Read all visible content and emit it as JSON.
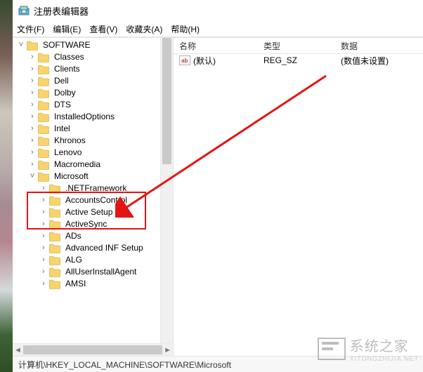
{
  "titlebar": {
    "title": "注册表编辑器"
  },
  "menu": {
    "file": "文件(F)",
    "edit": "编辑(E)",
    "view": "查看(V)",
    "favorites": "收藏夹(A)",
    "help": "帮助(H)"
  },
  "tree": [
    {
      "indent": 0,
      "expander": "open",
      "label": "SOFTWARE"
    },
    {
      "indent": 1,
      "expander": "close",
      "label": "Classes"
    },
    {
      "indent": 1,
      "expander": "close",
      "label": "Clients"
    },
    {
      "indent": 1,
      "expander": "close",
      "label": "Dell"
    },
    {
      "indent": 1,
      "expander": "close",
      "label": "Dolby"
    },
    {
      "indent": 1,
      "expander": "close",
      "label": "DTS"
    },
    {
      "indent": 1,
      "expander": "close",
      "label": "InstalledOptions"
    },
    {
      "indent": 1,
      "expander": "close",
      "label": "Intel"
    },
    {
      "indent": 1,
      "expander": "close",
      "label": "Khronos"
    },
    {
      "indent": 1,
      "expander": "close",
      "label": "Lenovo"
    },
    {
      "indent": 1,
      "expander": "close",
      "label": "Macromedia"
    },
    {
      "indent": 1,
      "expander": "open",
      "label": "Microsoft"
    },
    {
      "indent": 2,
      "expander": "close",
      "label": ".NETFramework"
    },
    {
      "indent": 2,
      "expander": "close",
      "label": "AccountsControl"
    },
    {
      "indent": 2,
      "expander": "close",
      "label": "Active Setup"
    },
    {
      "indent": 2,
      "expander": "close",
      "label": "ActiveSync"
    },
    {
      "indent": 2,
      "expander": "close",
      "label": "ADs"
    },
    {
      "indent": 2,
      "expander": "close",
      "label": "Advanced INF Setup"
    },
    {
      "indent": 2,
      "expander": "close",
      "label": "ALG"
    },
    {
      "indent": 2,
      "expander": "close",
      "label": "AllUserInstallAgent"
    },
    {
      "indent": 2,
      "expander": "close",
      "label": "AMSI"
    }
  ],
  "list": {
    "columns": {
      "name": "名称",
      "type": "类型",
      "data": "数据"
    },
    "rows": [
      {
        "name": "(默认)",
        "type": "REG_SZ",
        "data": "(数值未设置)"
      }
    ]
  },
  "statusbar": {
    "path": "计算机\\HKEY_LOCAL_MACHINE\\SOFTWARE\\Microsoft"
  },
  "watermark": {
    "text": "系统之家",
    "sub": "XITONGZHIJIA.NET"
  }
}
